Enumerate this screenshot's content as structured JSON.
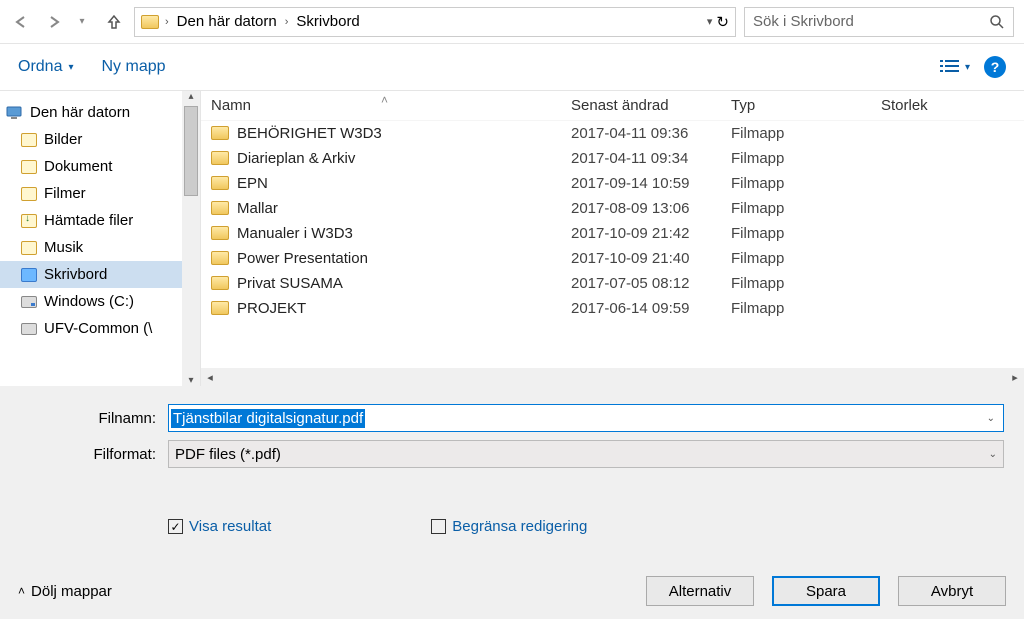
{
  "address_bar": {
    "crumb1": "Den här datorn",
    "crumb2": "Skrivbord",
    "refresh_icon": "↻"
  },
  "search": {
    "placeholder": "Sök i Skrivbord"
  },
  "commands": {
    "organize": "Ordna",
    "new_folder": "Ny mapp"
  },
  "nav_tree": {
    "root": "Den här datorn",
    "items": [
      {
        "label": "Bilder",
        "icon": "lib"
      },
      {
        "label": "Dokument",
        "icon": "lib"
      },
      {
        "label": "Filmer",
        "icon": "lib"
      },
      {
        "label": "Hämtade filer",
        "icon": "dl"
      },
      {
        "label": "Musik",
        "icon": "lib"
      },
      {
        "label": "Skrivbord",
        "icon": "desk",
        "selected": true
      },
      {
        "label": "Windows (C:)",
        "icon": "drive"
      },
      {
        "label": "UFV-Common (\\",
        "icon": "net"
      }
    ]
  },
  "file_list": {
    "headers": {
      "name": "Namn",
      "date": "Senast ändrad",
      "type": "Typ",
      "size": "Storlek"
    },
    "rows": [
      {
        "name": "BEHÖRIGHET W3D3",
        "date": "2017-04-11 09:36",
        "type": "Filmapp"
      },
      {
        "name": "Diarieplan & Arkiv",
        "date": "2017-04-11 09:34",
        "type": "Filmapp"
      },
      {
        "name": "EPN",
        "date": "2017-09-14 10:59",
        "type": "Filmapp"
      },
      {
        "name": "Mallar",
        "date": "2017-08-09 13:06",
        "type": "Filmapp"
      },
      {
        "name": "Manualer i W3D3",
        "date": "2017-10-09 21:42",
        "type": "Filmapp"
      },
      {
        "name": "Power Presentation",
        "date": "2017-10-09 21:40",
        "type": "Filmapp"
      },
      {
        "name": "Privat SUSAMA",
        "date": "2017-07-05 08:12",
        "type": "Filmapp"
      },
      {
        "name": "PROJEKT",
        "date": "2017-06-14 09:59",
        "type": "Filmapp"
      }
    ]
  },
  "fields": {
    "filename_label": "Filnamn:",
    "filename_value": "Tjänstbilar digitalsignatur.pdf",
    "filetype_label": "Filformat:",
    "filetype_value": "PDF files (*.pdf)"
  },
  "checkboxes": {
    "view_result": {
      "label": "Visa resultat",
      "checked": true
    },
    "restrict_editing": {
      "label": "Begränsa redigering",
      "checked": false
    }
  },
  "footer": {
    "hide_folders": "Dölj mappar",
    "alternatives": "Alternativ",
    "save": "Spara",
    "cancel": "Avbryt"
  }
}
